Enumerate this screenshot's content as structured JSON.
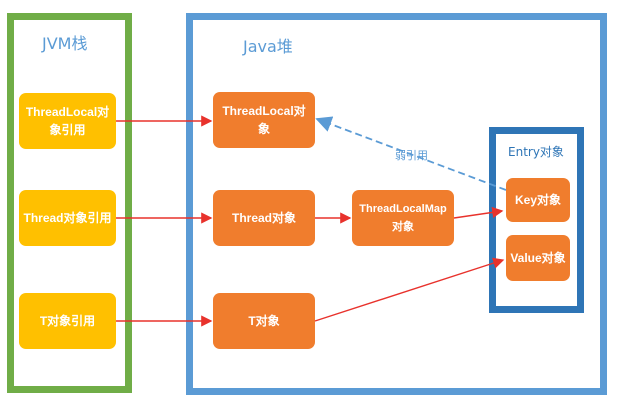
{
  "jvm_stack": {
    "title": "JVM栈",
    "items": [
      "ThreadLocal对象引用",
      "Thread对象引用",
      "T对象引用"
    ]
  },
  "java_heap": {
    "title": "Java堆",
    "items": [
      "ThreadLocal对象",
      "Thread对象",
      "T对象",
      "ThreadLocalMap对象"
    ]
  },
  "entry": {
    "title": "Entry对象",
    "key": "Key对象",
    "value": "Value对象"
  },
  "weak_ref_label": "弱引用",
  "colors": {
    "stack_border": "#70ad47",
    "heap_border": "#5b9bd5",
    "entry_border": "#2e75b6",
    "yellow_box": "#ffc000",
    "orange_box": "#f07d2d",
    "arrow_red": "#e8322c",
    "arrow_weak": "#5b9bd5"
  }
}
